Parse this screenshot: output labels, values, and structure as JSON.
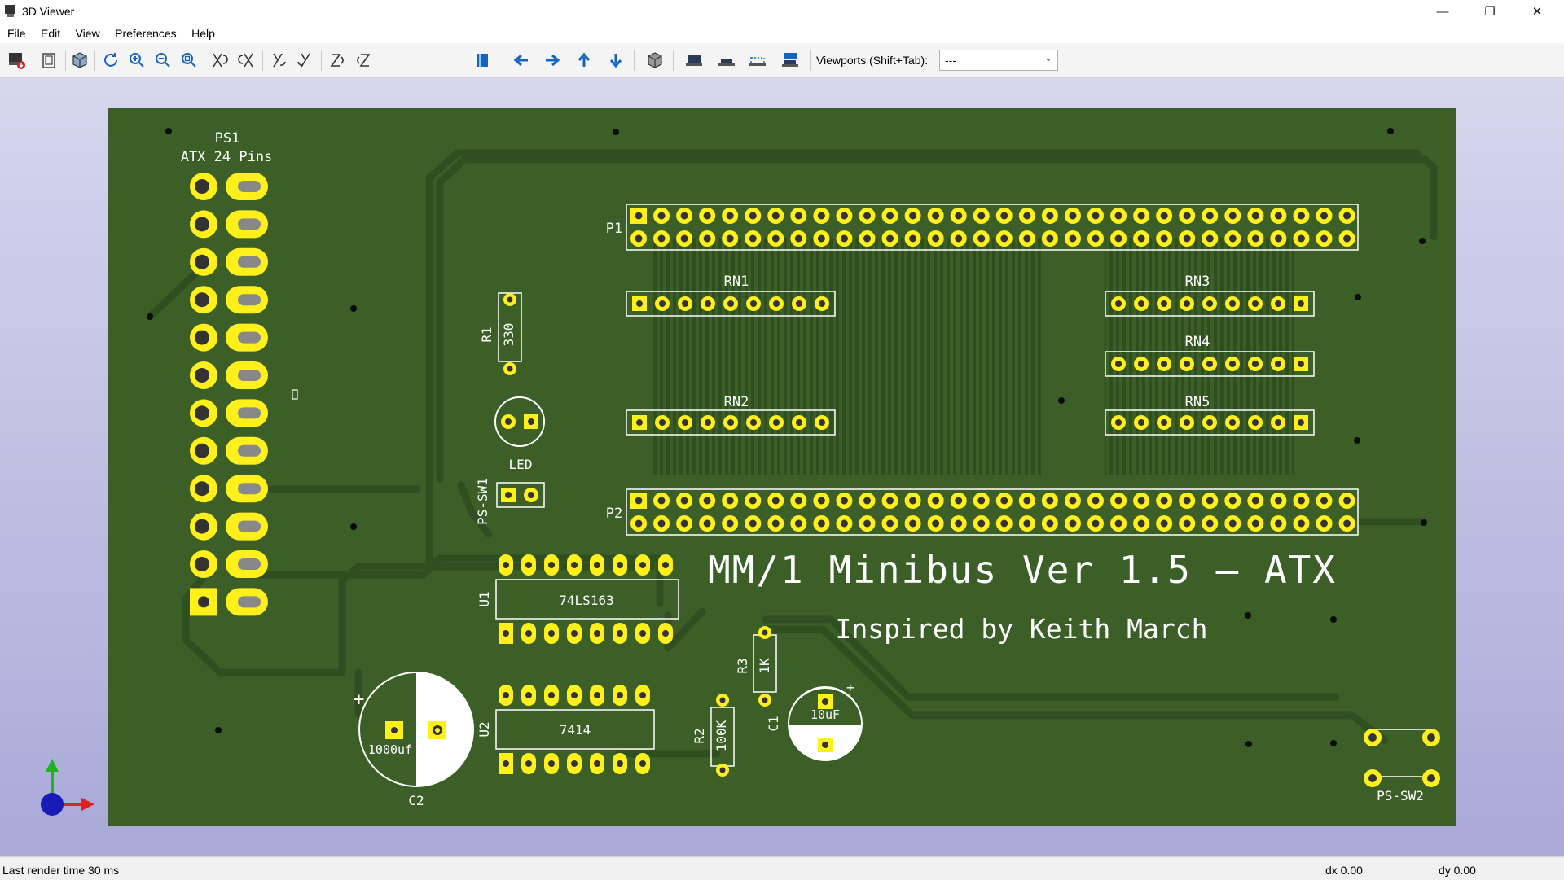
{
  "window": {
    "title": "3D Viewer",
    "controls": {
      "minimize": "—",
      "restore": "❐",
      "close": "✕"
    }
  },
  "menu": [
    "File",
    "Edit",
    "View",
    "Preferences",
    "Help"
  ],
  "toolbar": {
    "buttons": [
      "export-image",
      "copy-clipboard",
      "view-3d",
      "reload",
      "zoom-in",
      "zoom-out",
      "zoom-fit",
      "rotate-x-cw",
      "rotate-x-ccw",
      "rotate-y-cw",
      "rotate-y-ccw",
      "rotate-z-cw",
      "rotate-z-ccw",
      "flip-board",
      "pan-left",
      "pan-right",
      "pan-up",
      "pan-down",
      "ortho-toggle",
      "show-tht",
      "show-smd",
      "show-virtual",
      "show-not-in-pos"
    ],
    "viewports_label": "Viewports (Shift+Tab):",
    "viewports_value": "---"
  },
  "board": {
    "title_text": "MM/1 Minibus Ver 1.5 — ATX",
    "subtitle_text": "Inspired by Keith March",
    "colors": {
      "substrate": "#3b5f27",
      "trace": "#2f4f20",
      "pad": "#ffef1a",
      "silk": "#ffffff"
    },
    "labels": {
      "ps1": "PS1",
      "ps1_desc": "ATX 24 Pins",
      "p1": "P1",
      "p2": "P2",
      "rn1": "RN1",
      "rn2": "RN2",
      "rn3": "RN3",
      "rn4": "RN4",
      "rn5": "RN5",
      "r1": "R1",
      "r1_val": "330",
      "r2": "R2",
      "r2_val": "100K",
      "r3": "R3",
      "r3_val": "1K",
      "led": "LED",
      "ps_sw1": "PS-SW1",
      "ps_sw2": "PS-SW2",
      "u1": "U1",
      "u1_val": "74LS163",
      "u2": "U2",
      "u2_val": "7414",
      "c1": "C1",
      "c1_val": "10uF",
      "c2": "C2",
      "c2_val": "1000uf"
    }
  },
  "status": {
    "render": "Last render time 30 ms",
    "dx": "dx 0.00",
    "dy": "dy 0.00"
  }
}
